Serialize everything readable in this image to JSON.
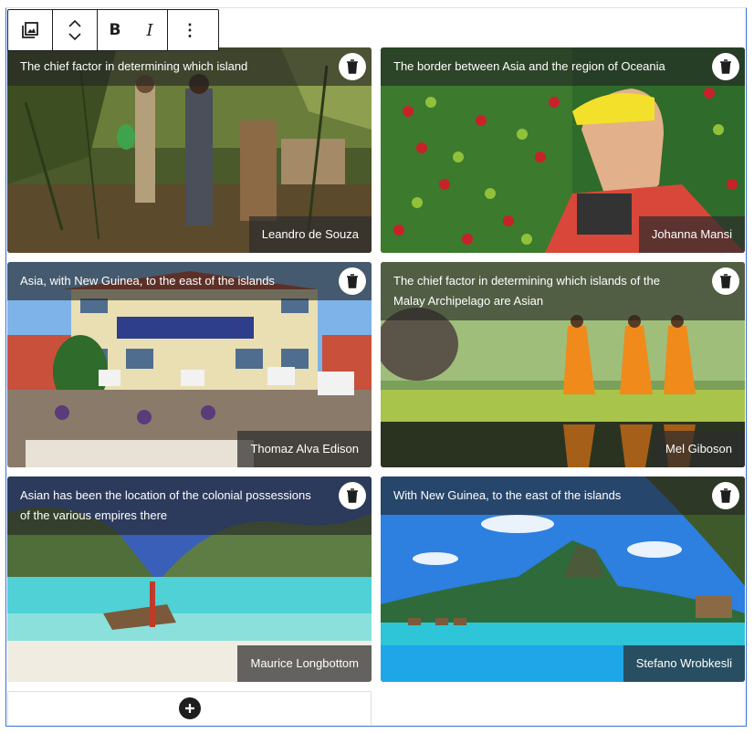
{
  "toolbar": {
    "items": [
      {
        "name": "image-gallery-icon",
        "label": ""
      },
      {
        "name": "move-up-down-icon",
        "label": ""
      },
      {
        "name": "bold-button",
        "label": "B"
      },
      {
        "name": "italic-button",
        "label": "I"
      },
      {
        "name": "more-options-icon",
        "label": "⋮"
      }
    ]
  },
  "gallery": {
    "images": [
      {
        "caption": "The chief factor in determining which island",
        "credit": "Leandro de Souza",
        "scene": "forest"
      },
      {
        "caption": "The border between Asia and the region of Oceania",
        "credit": "Johanna Mansi",
        "scene": "coffee"
      },
      {
        "caption": "Asia, with New Guinea, to the east of the islands",
        "credit": "Thomaz Alva Edison",
        "scene": "protest"
      },
      {
        "caption": "The chief factor in determining which islands of the Malay Archipelago are Asian",
        "credit": "Mel Giboson",
        "scene": "monks"
      },
      {
        "caption": "Asian has been the location of the colonial possessions of the various empires there",
        "credit": "Maurice Longbottom",
        "scene": "beach"
      },
      {
        "caption": "With New Guinea, to the east of the islands",
        "credit": "Stefano Wrobkesli",
        "scene": "island"
      }
    ],
    "delete_icon": "trash-icon",
    "add_icon": "plus-circle-icon"
  },
  "colors": {
    "accent": "#3b6fd6",
    "toolbar_border": "#1e1e1e",
    "caption_bg": "#232323"
  }
}
